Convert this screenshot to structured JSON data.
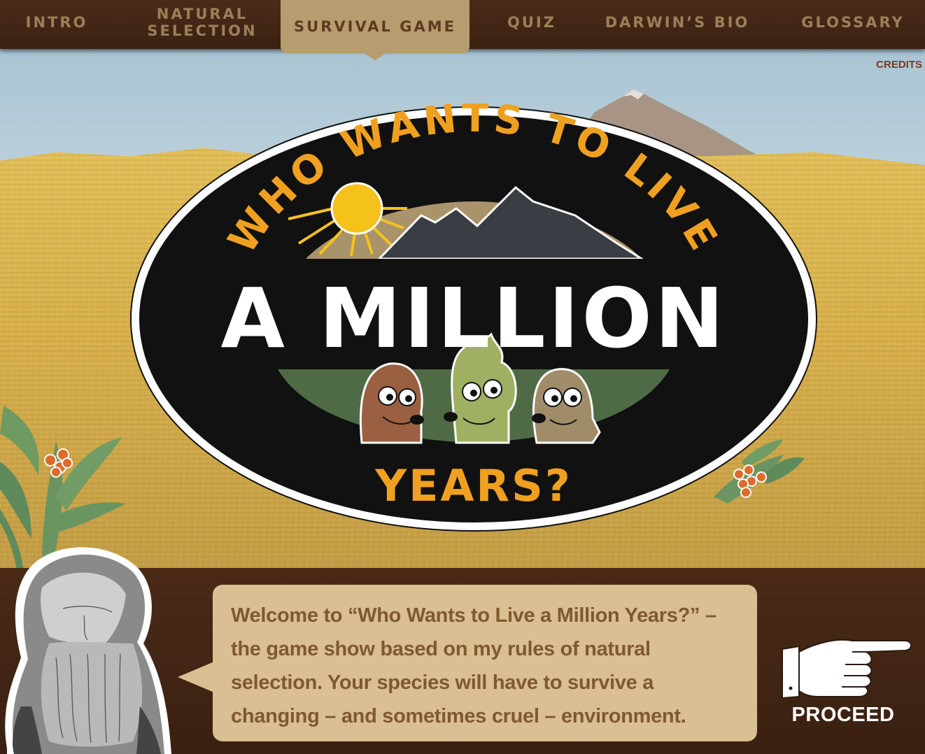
{
  "nav": {
    "items": [
      {
        "label": "INTRO"
      },
      {
        "label": "NATURAL SELECTION"
      },
      {
        "label": "SURVIVAL GAME",
        "active": true
      },
      {
        "label": "QUIZ"
      },
      {
        "label": "DARWIN’S BIO"
      },
      {
        "label": "GLOSSARY"
      }
    ],
    "credits": "CREDITS"
  },
  "logo": {
    "arc_text": "WHO WANTS TO LIVE",
    "main_text": "A MILLION",
    "bottom_text": "YEARS?"
  },
  "dialog": {
    "text": "Welcome to “Who Wants to Live a Million Years?” – the game show based on my rules of natural selection. Your species will have to survive a changing – and sometimes cruel – environment."
  },
  "proceed": {
    "label": "PROCEED"
  },
  "colors": {
    "nav_bg": "#3b2112",
    "nav_text": "#9a8058",
    "nav_active_bg": "#b69c6e",
    "logo_orange": "#f0a020",
    "bubble_bg": "#d9bf91",
    "bubble_text": "#80592f"
  }
}
